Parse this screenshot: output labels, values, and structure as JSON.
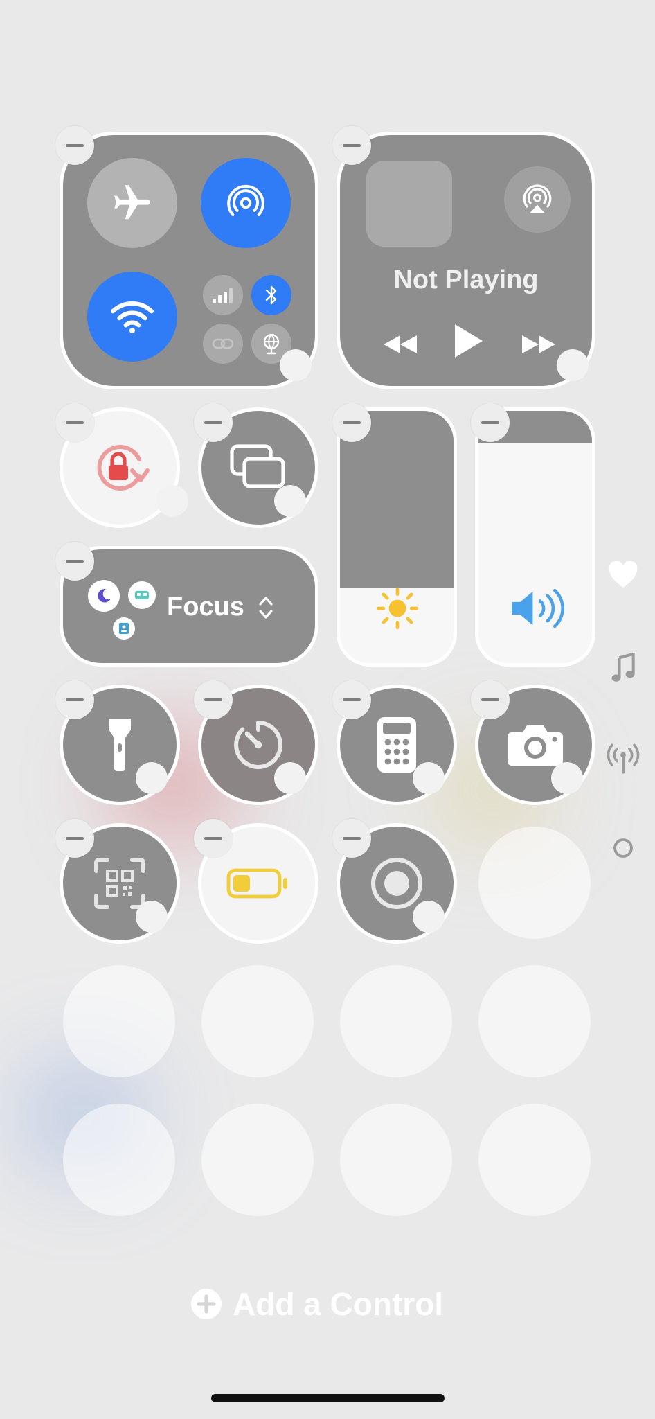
{
  "media": {
    "status": "Not Playing"
  },
  "focus": {
    "label": "Focus"
  },
  "add_control": {
    "label": "Add a Control"
  },
  "colors": {
    "tile": "#8e8e8e",
    "accent_blue": "#2f7cf6",
    "orientation_red": "#e64b4b",
    "battery_yellow": "#f2cd3a",
    "brightness_yellow": "#f6c230",
    "volume_blue": "#4aa3ea"
  },
  "levels": {
    "brightness": 0.3,
    "volume": 0.87
  },
  "icons": {
    "connectivity": [
      "airplane-icon",
      "airdrop-icon",
      "wifi-icon",
      "cellular-icon",
      "bluetooth-icon",
      "hotspot-icon",
      "vpn-icon"
    ],
    "controls": [
      "orientation-lock-icon",
      "screen-mirroring-icon",
      "flashlight-icon",
      "timer-icon",
      "calculator-icon",
      "camera-icon",
      "qr-scanner-icon",
      "low-power-icon",
      "screen-record-icon"
    ],
    "side": [
      "heart-icon",
      "music-note-icon",
      "signal-tower-icon",
      "page-dot-icon"
    ]
  }
}
